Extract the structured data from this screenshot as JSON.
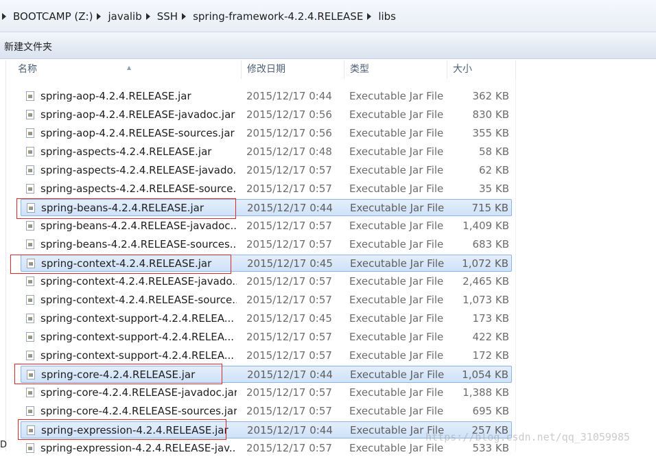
{
  "breadcrumb": [
    "BOOTCAMP (Z:)",
    "javalib",
    "SSH",
    "spring-framework-4.2.4.RELEASE",
    "libs"
  ],
  "toolbar": {
    "new_folder": "新建文件夹"
  },
  "columns": {
    "name": "名称",
    "date": "修改日期",
    "type": "类型",
    "size": "大小"
  },
  "files": [
    {
      "name": "spring-aop-4.2.4.RELEASE.jar",
      "date": "2015/12/17 0:44",
      "type": "Executable Jar File",
      "size": "362 KB",
      "selected": false
    },
    {
      "name": "spring-aop-4.2.4.RELEASE-javadoc.jar",
      "date": "2015/12/17 0:56",
      "type": "Executable Jar File",
      "size": "830 KB",
      "selected": false
    },
    {
      "name": "spring-aop-4.2.4.RELEASE-sources.jar",
      "date": "2015/12/17 0:56",
      "type": "Executable Jar File",
      "size": "355 KB",
      "selected": false
    },
    {
      "name": "spring-aspects-4.2.4.RELEASE.jar",
      "date": "2015/12/17 0:48",
      "type": "Executable Jar File",
      "size": "58 KB",
      "selected": false
    },
    {
      "name": "spring-aspects-4.2.4.RELEASE-javado...",
      "date": "2015/12/17 0:57",
      "type": "Executable Jar File",
      "size": "62 KB",
      "selected": false
    },
    {
      "name": "spring-aspects-4.2.4.RELEASE-source...",
      "date": "2015/12/17 0:57",
      "type": "Executable Jar File",
      "size": "35 KB",
      "selected": false
    },
    {
      "name": "spring-beans-4.2.4.RELEASE.jar",
      "date": "2015/12/17 0:44",
      "type": "Executable Jar File",
      "size": "715 KB",
      "selected": true
    },
    {
      "name": "spring-beans-4.2.4.RELEASE-javadoc....",
      "date": "2015/12/17 0:57",
      "type": "Executable Jar File",
      "size": "1,409 KB",
      "selected": false
    },
    {
      "name": "spring-beans-4.2.4.RELEASE-sources....",
      "date": "2015/12/17 0:57",
      "type": "Executable Jar File",
      "size": "683 KB",
      "selected": false
    },
    {
      "name": "spring-context-4.2.4.RELEASE.jar",
      "date": "2015/12/17 0:45",
      "type": "Executable Jar File",
      "size": "1,072 KB",
      "selected": true
    },
    {
      "name": "spring-context-4.2.4.RELEASE-javado...",
      "date": "2015/12/17 0:57",
      "type": "Executable Jar File",
      "size": "2,465 KB",
      "selected": false
    },
    {
      "name": "spring-context-4.2.4.RELEASE-source...",
      "date": "2015/12/17 0:57",
      "type": "Executable Jar File",
      "size": "1,073 KB",
      "selected": false
    },
    {
      "name": "spring-context-support-4.2.4.RELEA...",
      "date": "2015/12/17 0:45",
      "type": "Executable Jar File",
      "size": "173 KB",
      "selected": false
    },
    {
      "name": "spring-context-support-4.2.4.RELEA...",
      "date": "2015/12/17 0:57",
      "type": "Executable Jar File",
      "size": "422 KB",
      "selected": false
    },
    {
      "name": "spring-context-support-4.2.4.RELEA...",
      "date": "2015/12/17 0:57",
      "type": "Executable Jar File",
      "size": "172 KB",
      "selected": false
    },
    {
      "name": "spring-core-4.2.4.RELEASE.jar",
      "date": "2015/12/17 0:44",
      "type": "Executable Jar File",
      "size": "1,054 KB",
      "selected": true
    },
    {
      "name": "spring-core-4.2.4.RELEASE-javadoc.jar",
      "date": "2015/12/17 0:57",
      "type": "Executable Jar File",
      "size": "1,388 KB",
      "selected": false
    },
    {
      "name": "spring-core-4.2.4.RELEASE-sources.jar",
      "date": "2015/12/17 0:57",
      "type": "Executable Jar File",
      "size": "695 KB",
      "selected": false
    },
    {
      "name": "spring-expression-4.2.4.RELEASE.jar",
      "date": "2015/12/17 0:44",
      "type": "Executable Jar File",
      "size": "257 KB",
      "selected": true
    },
    {
      "name": "spring-expression-4.2.4.RELEASE-jav...",
      "date": "2015/12/17 0:57",
      "type": "Executable Jar File",
      "size": "533 KB",
      "selected": false
    }
  ],
  "watermark": "https://blog.csdn.net/qq_31059985",
  "left_edge_text": "D",
  "highlight_color": "#e0242b",
  "selection_color": "#cfe2f9",
  "icons": {
    "file": "jar-file-icon",
    "breadcrumb_separator": "chevron-right-icon",
    "sort": "sort-ascending-icon"
  }
}
